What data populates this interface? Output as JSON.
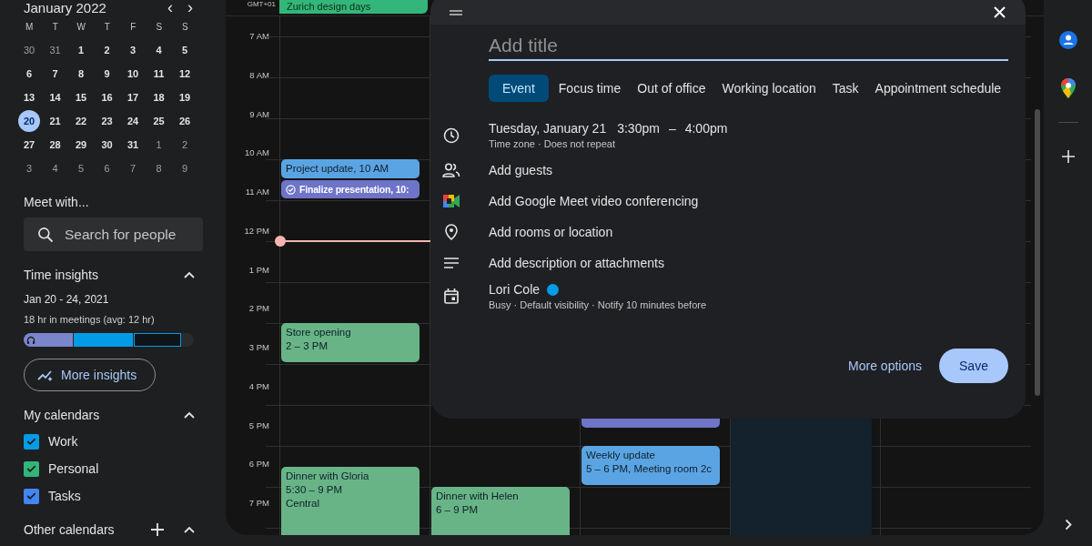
{
  "mini_calendar": {
    "month": "January 2022",
    "prev": "‹",
    "next": "›",
    "weekdays": [
      "M",
      "T",
      "W",
      "T",
      "F",
      "S",
      "S"
    ],
    "weeks": [
      [
        {
          "day": "30",
          "other_month": true,
          "selected": false
        },
        {
          "day": "31",
          "other_month": true,
          "selected": false
        },
        {
          "day": "1",
          "other_month": false,
          "selected": false
        },
        {
          "day": "2",
          "other_month": false,
          "selected": false
        },
        {
          "day": "3",
          "other_month": false,
          "selected": false
        },
        {
          "day": "4",
          "other_month": false,
          "selected": false
        },
        {
          "day": "5",
          "other_month": false,
          "selected": false
        }
      ],
      [
        {
          "day": "6",
          "other_month": false,
          "selected": false
        },
        {
          "day": "7",
          "other_month": false,
          "selected": false
        },
        {
          "day": "8",
          "other_month": false,
          "selected": false
        },
        {
          "day": "9",
          "other_month": false,
          "selected": false
        },
        {
          "day": "10",
          "other_month": false,
          "selected": false
        },
        {
          "day": "11",
          "other_month": false,
          "selected": false
        },
        {
          "day": "12",
          "other_month": false,
          "selected": false
        }
      ],
      [
        {
          "day": "13",
          "other_month": false,
          "selected": false
        },
        {
          "day": "14",
          "other_month": false,
          "selected": false
        },
        {
          "day": "15",
          "other_month": false,
          "selected": false
        },
        {
          "day": "16",
          "other_month": false,
          "selected": false
        },
        {
          "day": "17",
          "other_month": false,
          "selected": false
        },
        {
          "day": "18",
          "other_month": false,
          "selected": false
        },
        {
          "day": "19",
          "other_month": false,
          "selected": false
        }
      ],
      [
        {
          "day": "20",
          "other_month": false,
          "selected": true
        },
        {
          "day": "21",
          "other_month": false,
          "selected": false
        },
        {
          "day": "22",
          "other_month": false,
          "selected": false
        },
        {
          "day": "23",
          "other_month": false,
          "selected": false
        },
        {
          "day": "24",
          "other_month": false,
          "selected": false
        },
        {
          "day": "25",
          "other_month": false,
          "selected": false
        },
        {
          "day": "26",
          "other_month": false,
          "selected": false
        }
      ],
      [
        {
          "day": "27",
          "other_month": false,
          "selected": false
        },
        {
          "day": "28",
          "other_month": false,
          "selected": false
        },
        {
          "day": "29",
          "other_month": false,
          "selected": false
        },
        {
          "day": "30",
          "other_month": false,
          "selected": false
        },
        {
          "day": "31",
          "other_month": false,
          "selected": false
        },
        {
          "day": "1",
          "other_month": true,
          "selected": false
        },
        {
          "day": "2",
          "other_month": true,
          "selected": false
        }
      ],
      [
        {
          "day": "3",
          "other_month": true,
          "selected": false
        },
        {
          "day": "4",
          "other_month": true,
          "selected": false
        },
        {
          "day": "5",
          "other_month": true,
          "selected": false
        },
        {
          "day": "6",
          "other_month": true,
          "selected": false
        },
        {
          "day": "7",
          "other_month": true,
          "selected": false
        },
        {
          "day": "8",
          "other_month": true,
          "selected": false
        },
        {
          "day": "9",
          "other_month": true,
          "selected": false
        }
      ]
    ]
  },
  "meet_with": {
    "title": "Meet with...",
    "search": {
      "placeholder": "Search for people"
    }
  },
  "time_insights": {
    "title": "Time insights",
    "expanded": true,
    "range": "Jan 20 - 24, 2021",
    "summary": "18 hr in meetings (avg: 12 hr)",
    "button": "More insights"
  },
  "my_calendars": {
    "title": "My calendars",
    "expanded": true,
    "items": [
      {
        "label": "Work",
        "checked": true,
        "color": "#039be5"
      },
      {
        "label": "Personal",
        "checked": true,
        "color": "#33b679"
      },
      {
        "label": "Tasks",
        "checked": true,
        "color": "#4285f4"
      }
    ]
  },
  "other_calendars": {
    "title": "Other calendars",
    "expanded": true
  },
  "grid": {
    "timezone": "GMT+01",
    "all_day_event": {
      "title": "Zurich design days",
      "color": "#33b679"
    },
    "hours": [
      "7 AM",
      "8 AM",
      "9 AM",
      "10 AM",
      "11 AM",
      "12 PM",
      "1 PM",
      "2 PM",
      "3 PM",
      "4 PM",
      "5 PM",
      "6 PM",
      "7 PM"
    ],
    "columns": [
      {
        "events": [
          {
            "kind": "event",
            "title": "Project update, 10 AM",
            "color": "#5ba4e3"
          },
          {
            "kind": "task",
            "title": "Finalize presentation, 10:",
            "color": "#6e74c8"
          },
          {
            "kind": "event",
            "title": "Store opening",
            "details": [
              "2 – 3 PM"
            ],
            "color": "#68b486"
          },
          {
            "kind": "event",
            "title": "Dinner with Gloria",
            "details": [
              "5:30 – 9 PM",
              "Central"
            ],
            "color": "#68b486"
          }
        ]
      },
      {
        "events": [
          {
            "kind": "event",
            "title": "Dinner with Helen",
            "details": [
              "6 – 9 PM"
            ],
            "color": "#68b486"
          }
        ]
      },
      {
        "events": [
          {
            "kind": "task",
            "color": "#6e74c8"
          },
          {
            "kind": "event",
            "title": "Weekly update",
            "details": [
              "5 – 6 PM, Meeting room 2c"
            ],
            "color": "#5ba4e3"
          }
        ]
      }
    ]
  },
  "dialog": {
    "title": {
      "placeholder": "Add title"
    },
    "tabs": [
      {
        "label": "Event",
        "selected": true
      },
      {
        "label": "Focus time",
        "selected": false
      },
      {
        "label": "Out of office",
        "selected": false
      },
      {
        "label": "Working location",
        "selected": false
      },
      {
        "label": "Task",
        "selected": false
      },
      {
        "label": "Appointment schedule",
        "selected": false
      }
    ],
    "rows": [
      {
        "kind": "datetime",
        "date": "Tuesday, January 21",
        "start": "3:30pm",
        "dash": "–",
        "end": "4:00pm",
        "details": "Time zone · Does not repeat"
      },
      {
        "kind": "guests",
        "label": "Add guests"
      },
      {
        "kind": "meet",
        "label": "Add Google Meet video conferencing"
      },
      {
        "kind": "location",
        "label": "Add rooms or location"
      },
      {
        "kind": "description",
        "label": "Add description or attachments"
      },
      {
        "kind": "calendar",
        "label": "Lori Cole",
        "color": "#039be5",
        "details": "Busy · Default visibility · Notify 10 minutes before"
      }
    ],
    "more_options": "More options",
    "save": "Save"
  }
}
